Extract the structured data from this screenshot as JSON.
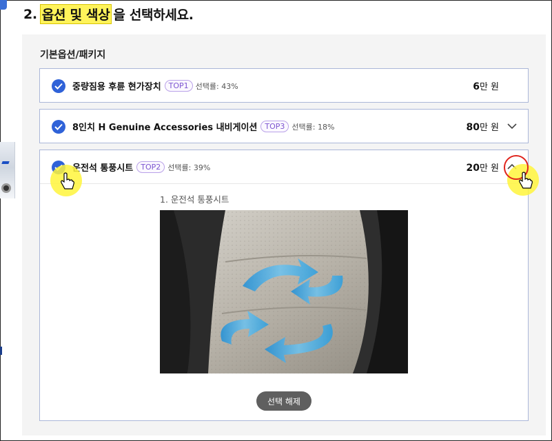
{
  "section": {
    "number": "2.",
    "highlight": "옵션 및 색상",
    "suffix": "을 선택하세요."
  },
  "group_label": "기본옵션/패키지",
  "options": [
    {
      "name": "중량짐용 후륜 현가장치",
      "badge": "TOP1",
      "rate": "선택률: 43%",
      "price_num": "6",
      "price_unit": "만 원",
      "checked": true,
      "expanded": false,
      "chevron": "none"
    },
    {
      "name": "8인치 H Genuine Accessories 내비게이션",
      "badge": "TOP3",
      "rate": "선택률: 18%",
      "price_num": "80",
      "price_unit": "만 원",
      "checked": true,
      "expanded": false,
      "chevron": "chevron-down-icon"
    },
    {
      "name": "운전석 통풍시트",
      "badge": "TOP2",
      "rate": "선택률: 39%",
      "price_num": "20",
      "price_unit": "만 원",
      "checked": true,
      "expanded": true,
      "chevron": "chevron-up-icon",
      "detail": {
        "caption": "1. 운전석 통풍시트",
        "image": "ventilated-seat-photo",
        "deselect_label": "선택 해제"
      }
    }
  ],
  "colors": {
    "accent": "#2f62d8",
    "highlight": "#fff35a",
    "badge": "#7c55d0",
    "panel_bg": "#f4f4f4",
    "card_border": "#aab6d8",
    "click_ring": "#e0241c"
  }
}
